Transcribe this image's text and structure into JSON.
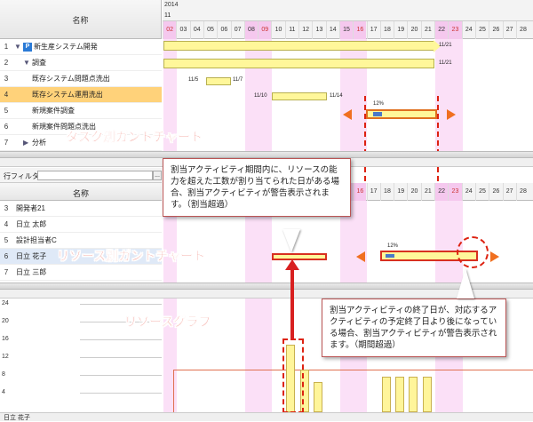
{
  "header": {
    "name_label": "名称",
    "year": "2014",
    "month": "11"
  },
  "days": [
    "02",
    "03",
    "04",
    "05",
    "06",
    "07",
    "08",
    "09",
    "10",
    "11",
    "12",
    "13",
    "14",
    "15",
    "16",
    "17",
    "18",
    "19",
    "20",
    "21",
    "22",
    "23",
    "24",
    "25",
    "26",
    "27",
    "28"
  ],
  "task_rows": [
    {
      "num": "1",
      "label": "新生産システム開発",
      "indent": 0
    },
    {
      "num": "2",
      "label": "調査",
      "indent": 1
    },
    {
      "num": "3",
      "label": "既存システム問題点洗出",
      "indent": 2
    },
    {
      "num": "4",
      "label": "既存システム運用洗出",
      "indent": 2
    },
    {
      "num": "5",
      "label": "新規案件調査",
      "indent": 2
    },
    {
      "num": "6",
      "label": "新規案件問題点洗出",
      "indent": 2
    },
    {
      "num": "7",
      "label": "分析",
      "indent": 1
    }
  ],
  "task_bar_labels": {
    "r1_end": "11/21",
    "r2_end": "11/21",
    "r3_start": "11/5",
    "r3_end": "11/7",
    "r4_start": "11/10",
    "r4_end": "11/14",
    "r5_pct": "12%"
  },
  "filter": {
    "label": "行フィルタ",
    "button": "..."
  },
  "resource_header": "名称",
  "resource_rows": [
    {
      "num": "3",
      "label": "開発者21"
    },
    {
      "num": "4",
      "label": "日立 太郎"
    },
    {
      "num": "5",
      "label": "設計担当者C"
    },
    {
      "num": "6",
      "label": "日立 花子"
    },
    {
      "num": "7",
      "label": "日立 三郎"
    }
  ],
  "resource_bar_pct": "12%",
  "graph": {
    "labels": [
      "24",
      "20",
      "16",
      "12",
      "8",
      "4"
    ],
    "footer": "日立 花子"
  },
  "titles": {
    "task": "タスク別ガントチャート",
    "resource": "リソース別ガントチャート",
    "graph": "リソースグラフ"
  },
  "callouts": {
    "over_alloc": "割当アクティビティ期間内に、リソースの能力を超えた工数が割り当てられた日がある場合、割当アクティビティが警告表示されます。（割当超過）",
    "over_period": "割当アクティビティの終了日が、対応するアクティビティの予定終了日より後になっている場合、割当アクティビティが警告表示されます。（期間超過）"
  }
}
